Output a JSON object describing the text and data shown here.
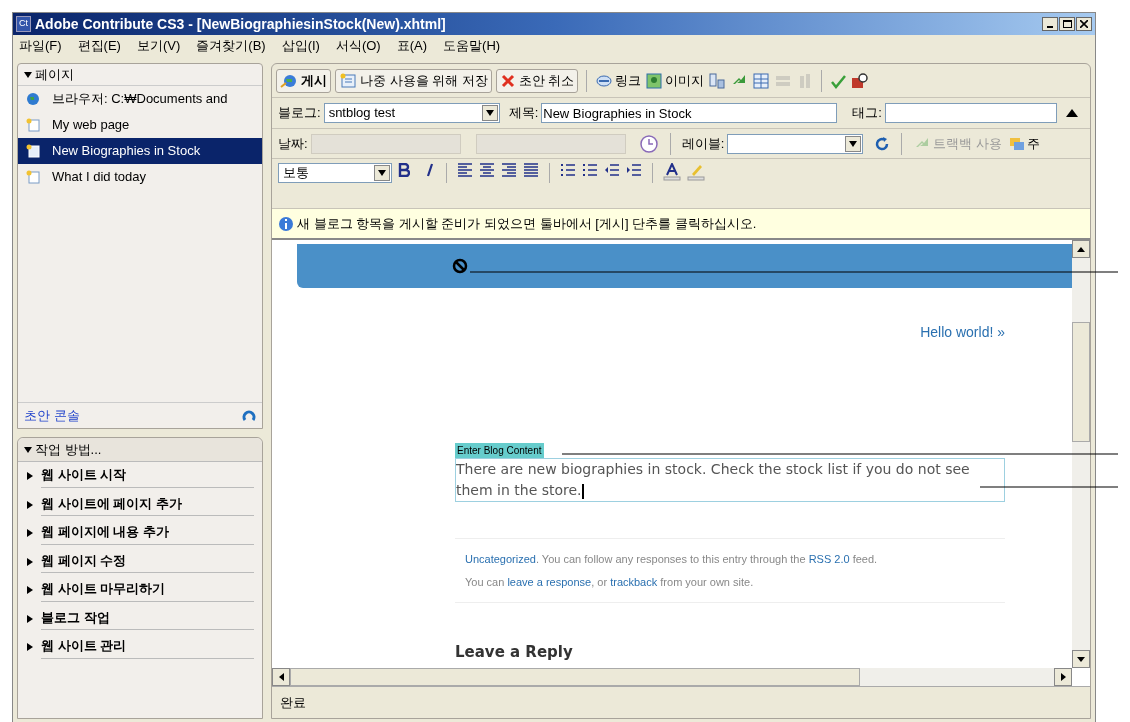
{
  "window": {
    "badge": "Ct",
    "title": "Adobe Contribute CS3 - [NewBiographiesinStock(New).xhtml]"
  },
  "menu": [
    "파일(F)",
    "편집(E)",
    "보기(V)",
    "즐겨찾기(B)",
    "삽입(I)",
    "서식(O)",
    "표(A)",
    "도움말(H)"
  ],
  "pages_panel": {
    "title": "페이지",
    "expanded": true,
    "footer": "초안 콘솔",
    "items": [
      {
        "label": "브라우저: C:₩Documents and",
        "kind": "browser",
        "selected": false
      },
      {
        "label": "My web page",
        "kind": "page",
        "selected": false
      },
      {
        "label": "New Biographies in Stock",
        "kind": "draft",
        "selected": true
      },
      {
        "label": "What I did today",
        "kind": "page",
        "selected": false
      }
    ]
  },
  "howto_panel": {
    "title": "작업 방법...",
    "expanded": true,
    "items": [
      {
        "label": "웹 사이트 시작",
        "expanded": false
      },
      {
        "label": "웹 사이트에 페이지 추가",
        "expanded": false
      },
      {
        "label": "웹 페이지에 내용 추가",
        "expanded": false
      },
      {
        "label": "웹 페이지 수정",
        "expanded": false
      },
      {
        "label": "웹 사이트 마무리하기",
        "expanded": false
      },
      {
        "label": "블로그 작업",
        "expanded": false
      },
      {
        "label": "웹 사이트 관리",
        "expanded": false
      }
    ]
  },
  "toolbar": {
    "buttons": [
      {
        "label": "게시",
        "kind": "publish"
      },
      {
        "label": "나중 사용을 위해 저장",
        "kind": "save"
      },
      {
        "label": "초안 취소",
        "kind": "cancel"
      }
    ],
    "tools": [
      {
        "kind": "link",
        "label": "링크",
        "disabled": false
      },
      {
        "kind": "image",
        "label": "이미지",
        "disabled": false
      },
      {
        "kind": "insert",
        "disabled": false
      },
      {
        "kind": "sync",
        "disabled": false
      },
      {
        "kind": "table",
        "disabled": false
      },
      {
        "kind": "rows",
        "disabled": true
      },
      {
        "kind": "columns",
        "disabled": true
      },
      {
        "kind": "spell",
        "disabled": false
      },
      {
        "kind": "preview",
        "disabled": false
      }
    ]
  },
  "blog_row": {
    "blog_label": "블로그:",
    "blog_value": "sntblog test",
    "title_label": "제목:",
    "title_value": "New Biographies in Stock",
    "tag_label": "태그:"
  },
  "date_row": {
    "date_label": "날짜:",
    "label_label": "레이블:",
    "trackback": {
      "label": "트랙백 사용",
      "disabled": true
    },
    "comments": "주"
  },
  "format_row": {
    "style": "보통"
  },
  "info": "새 블로그 항목을 게시할 준비가 되었으면 툴바에서 [게시] 단추를 클릭하십시오.",
  "document": {
    "next_link": "Hello world! »",
    "content_label": "Enter Blog Content",
    "content": "There are new biographies in stock. Check the stock list if you do not see them in the store.",
    "meta": [
      [
        {
          "text": "Uncategorized",
          "link": true
        },
        {
          "text": ". You can follow any responses to this entry through the ",
          "link": false
        },
        {
          "text": "RSS 2.0",
          "link": true
        },
        {
          "text": " feed.",
          "link": false
        }
      ],
      [
        {
          "text": "You can ",
          "link": false
        },
        {
          "text": "leave a response",
          "link": true
        },
        {
          "text": ", or ",
          "link": false
        },
        {
          "text": "trackback",
          "link": true
        },
        {
          "text": " from your own site.",
          "link": false
        }
      ]
    ],
    "heading": "Leave a Reply"
  },
  "status": "완료"
}
